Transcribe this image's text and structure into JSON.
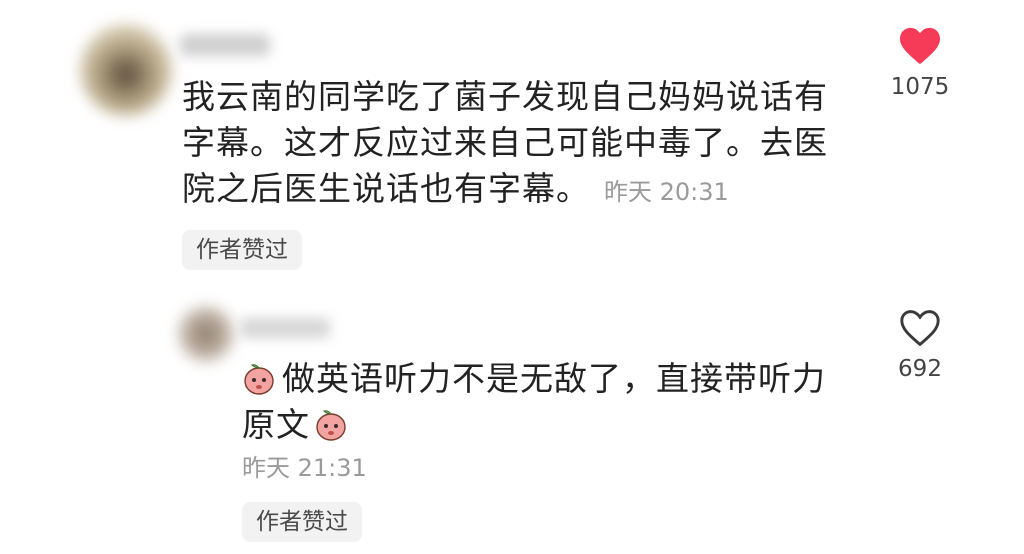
{
  "comment": {
    "text_line1": "我云南的同学吃了菌子发现自己妈妈说话有",
    "text_line2": "字幕。这才反应过来自己可能中毒了。去医",
    "text_line3": "院之后医生说话也有字幕。",
    "time": "昨天 20:31",
    "liked_tag": "作者赞过",
    "like_count": "1075",
    "liked": true
  },
  "reply": {
    "text_line1": "做英语听力不是无敌了，直接带听力",
    "text_line2": "原文",
    "time": "昨天 21:31",
    "liked_tag": "作者赞过",
    "like_count": "692",
    "liked": false
  },
  "icons": {
    "like_filled": "heart-filled-icon",
    "like_outline": "heart-outline-icon",
    "emoji": "peach-emoji-icon"
  },
  "colors": {
    "heart_red": "#f53b57",
    "heart_outline": "#3a3a3a"
  }
}
